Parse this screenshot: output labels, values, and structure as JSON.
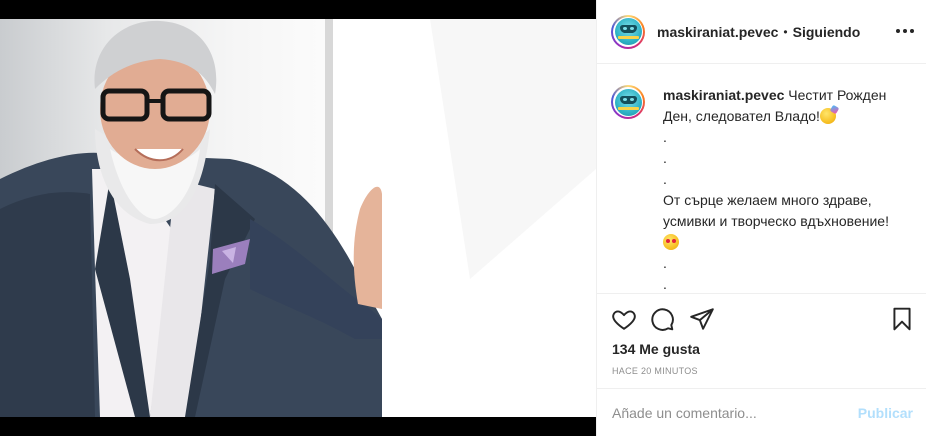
{
  "post": {
    "username": "maskiraniat.pevec",
    "separator": "•",
    "follow_status": "Siguiendo",
    "avatar_icon": "masquerade-mask-logo",
    "caption": {
      "author": "maskiraniat.pevec",
      "lines": [
        "Честит Рожден",
        "Ден, следовател Владо!",
        ".",
        ".",
        ".",
        "От сърце желаем много здраве,",
        "усмивки и творческо вдъхновение!",
        "",
        ".",
        ".",
        "."
      ]
    },
    "likes_text": "134 Me gusta",
    "timestamp": "HACE 20 MINUTOS",
    "comment_placeholder": "Añade un comentario...",
    "publish_label": "Publicar"
  },
  "colors": {
    "text": "#262626",
    "muted": "#8e8e8e",
    "publish_disabled": "#b2dffc",
    "divider": "#efefef"
  }
}
